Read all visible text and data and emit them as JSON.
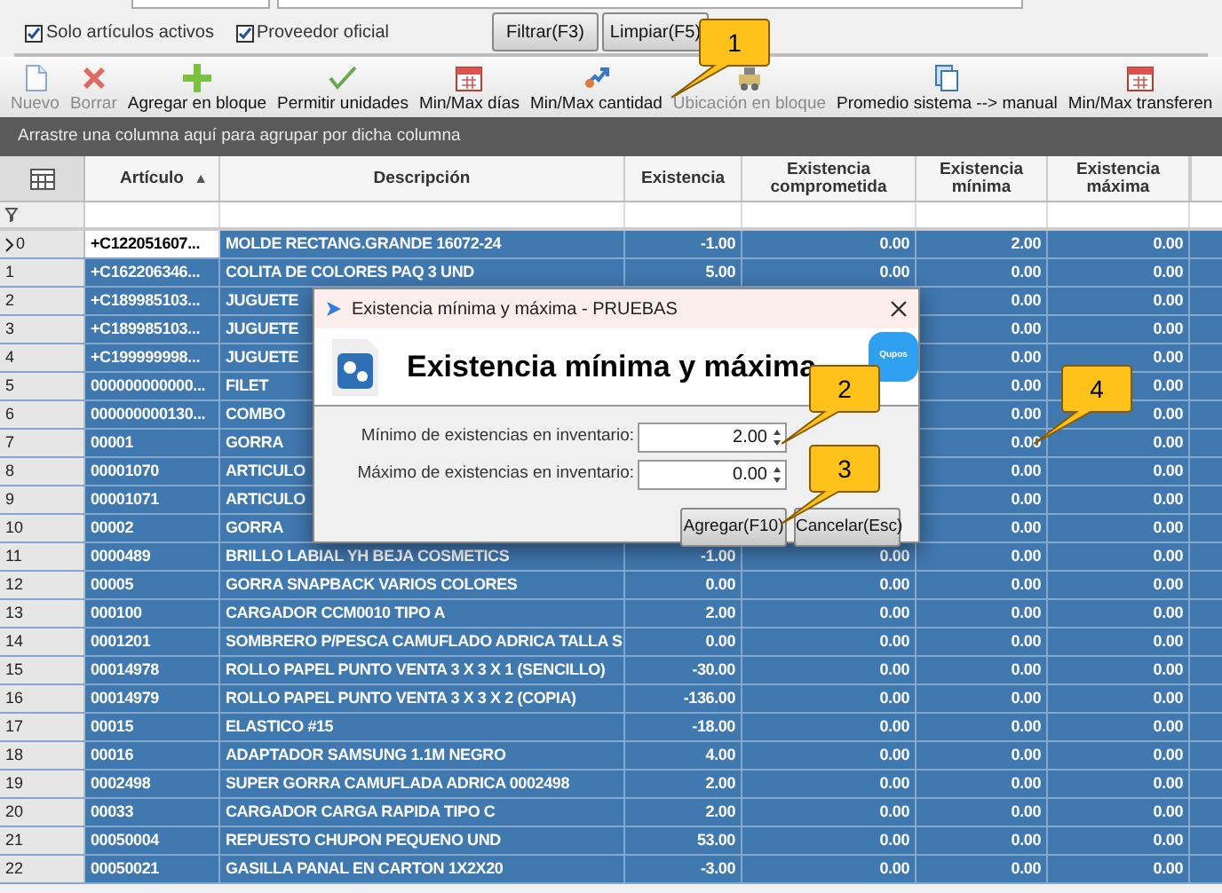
{
  "filters": {
    "checkboxes": [
      {
        "label": "Solo artículos activos",
        "checked": true
      },
      {
        "label": "Proveedor oficial",
        "checked": true
      }
    ],
    "buttons": [
      "Filtrar(F3)",
      "Limpiar(F5)"
    ]
  },
  "toolbar": [
    {
      "label": "Nuevo",
      "kind": "new",
      "disabled": true
    },
    {
      "label": "Borrar",
      "kind": "delete",
      "disabled": true
    },
    {
      "label": "Agregar en bloque",
      "kind": "add",
      "disabled": false
    },
    {
      "label": "Permitir unidades",
      "kind": "check",
      "disabled": false
    },
    {
      "label": "Min/Max días",
      "kind": "calendar",
      "disabled": false
    },
    {
      "label": "Min/Max cantidad",
      "kind": "swap",
      "disabled": false
    },
    {
      "label": "Ubicación en bloque",
      "kind": "machine",
      "disabled": true
    },
    {
      "label": "Promedio sistema --> manual",
      "kind": "copy",
      "disabled": false
    },
    {
      "label": "Min/Max transferen",
      "kind": "calendar",
      "disabled": false
    }
  ],
  "group_panel": "Arrastre una columna aquí para agrupar por dicha columna",
  "table": {
    "columns": [
      {
        "label": "Artículo",
        "sort_marker": "▲"
      },
      {
        "label": "Descripción"
      },
      {
        "label": "Existencia"
      },
      {
        "label": "Existencia comprometida"
      },
      {
        "label": "Existencia mínima"
      },
      {
        "label": "Existencia máxima"
      }
    ],
    "rows": [
      {
        "index": "0",
        "current": true,
        "selected": true,
        "cells": [
          "+C122051607...",
          "MOLDE RECTANG.GRANDE 16072-24",
          "-1.00",
          "0.00",
          "2.00",
          "0.00"
        ]
      },
      {
        "index": "1",
        "current": false,
        "selected": true,
        "cells": [
          "+C162206346...",
          "COLITA DE COLORES PAQ 3 UND",
          "5.00",
          "0.00",
          "0.00",
          "0.00"
        ]
      },
      {
        "index": "2",
        "current": false,
        "selected": true,
        "cells": [
          "+C189985103...",
          "JUGUETE",
          null,
          null,
          "0.00",
          "0.00"
        ]
      },
      {
        "index": "3",
        "current": false,
        "selected": true,
        "cells": [
          "+C189985103...",
          "JUGUETE",
          null,
          null,
          "0.00",
          "0.00"
        ]
      },
      {
        "index": "4",
        "current": false,
        "selected": true,
        "cells": [
          "+C199999998...",
          "JUGUETE",
          null,
          null,
          "0.00",
          "0.00"
        ]
      },
      {
        "index": "5",
        "current": false,
        "selected": true,
        "cells": [
          "000000000000...",
          "FILET",
          null,
          null,
          "0.00",
          "0.00"
        ]
      },
      {
        "index": "6",
        "current": false,
        "selected": true,
        "cells": [
          "000000000130...",
          "COMBO",
          null,
          null,
          "0.00",
          "0.00"
        ]
      },
      {
        "index": "7",
        "current": false,
        "selected": true,
        "cells": [
          "00001",
          "GORRA",
          null,
          null,
          "0.00",
          "0.00"
        ]
      },
      {
        "index": "8",
        "current": false,
        "selected": true,
        "cells": [
          "00001070",
          "ARTICULO",
          null,
          null,
          "0.00",
          "0.00"
        ]
      },
      {
        "index": "9",
        "current": false,
        "selected": true,
        "cells": [
          "00001071",
          "ARTICULO",
          null,
          null,
          "0.00",
          "0.00"
        ]
      },
      {
        "index": "10",
        "current": false,
        "selected": true,
        "cells": [
          "00002",
          "GORRA",
          null,
          null,
          "0.00",
          "0.00"
        ]
      },
      {
        "index": "11",
        "current": false,
        "selected": true,
        "cells": [
          "0000489",
          "BRILLO LABIAL YH BEJA COSMETICS",
          "-1.00",
          "0.00",
          "0.00",
          "0.00"
        ]
      },
      {
        "index": "12",
        "current": false,
        "selected": true,
        "cells": [
          "00005",
          "GORRA SNAPBACK VARIOS COLORES",
          "0.00",
          "0.00",
          "0.00",
          "0.00"
        ]
      },
      {
        "index": "13",
        "current": false,
        "selected": true,
        "cells": [
          "000100",
          "CARGADOR CCM0010 TIPO A",
          "2.00",
          "0.00",
          "0.00",
          "0.00"
        ]
      },
      {
        "index": "14",
        "current": false,
        "selected": true,
        "cells": [
          "0001201",
          "SOMBRERO P/PESCA CAMUFLADO ADRICA TALLA S",
          "0.00",
          "0.00",
          "0.00",
          "0.00"
        ]
      },
      {
        "index": "15",
        "current": false,
        "selected": true,
        "cells": [
          "00014978",
          "ROLLO PAPEL PUNTO VENTA 3 X 3 X 1 (SENCILLO)",
          "-30.00",
          "0.00",
          "0.00",
          "0.00"
        ]
      },
      {
        "index": "16",
        "current": false,
        "selected": true,
        "cells": [
          "00014979",
          "ROLLO PAPEL PUNTO VENTA 3 X 3 X 2 (COPIA)",
          "-136.00",
          "0.00",
          "0.00",
          "0.00"
        ]
      },
      {
        "index": "17",
        "current": false,
        "selected": true,
        "cells": [
          "00015",
          "ELASTICO #15",
          "-18.00",
          "0.00",
          "0.00",
          "0.00"
        ]
      },
      {
        "index": "18",
        "current": false,
        "selected": true,
        "cells": [
          "00016",
          "ADAPTADOR SAMSUNG 1.1M NEGRO",
          "4.00",
          "0.00",
          "0.00",
          "0.00"
        ]
      },
      {
        "index": "19",
        "current": false,
        "selected": true,
        "cells": [
          "0002498",
          "SUPER GORRA CAMUFLADA ADRICA 0002498",
          "2.00",
          "0.00",
          "0.00",
          "0.00"
        ]
      },
      {
        "index": "20",
        "current": false,
        "selected": true,
        "cells": [
          "00033",
          "CARGADOR CARGA RAPIDA TIPO C",
          "2.00",
          "0.00",
          "0.00",
          "0.00"
        ]
      },
      {
        "index": "21",
        "current": false,
        "selected": true,
        "cells": [
          "00050004",
          "REPUESTO CHUPON PEQUENO UND",
          "53.00",
          "0.00",
          "0.00",
          "0.00"
        ]
      },
      {
        "index": "22",
        "current": false,
        "selected": true,
        "cells": [
          "00050021",
          "GASILLA PANAL EN CARTON 1X2X20",
          "-3.00",
          "0.00",
          "0.00",
          "0.00"
        ]
      }
    ]
  },
  "dialog": {
    "title": "Existencia mínima y máxima - PRUEBAS",
    "heading": "Existencia mínima y máxima",
    "logo_text": "Qupos",
    "fields": [
      {
        "label": "Mínimo de existencias en inventario:",
        "value": "2.00"
      },
      {
        "label": "Máximo de existencias en inventario:",
        "value": "0.00"
      }
    ],
    "buttons": [
      "Agregar(F10)",
      "Cancelar(Esc)"
    ]
  },
  "callouts": [
    "1",
    "2",
    "3",
    "4"
  ]
}
